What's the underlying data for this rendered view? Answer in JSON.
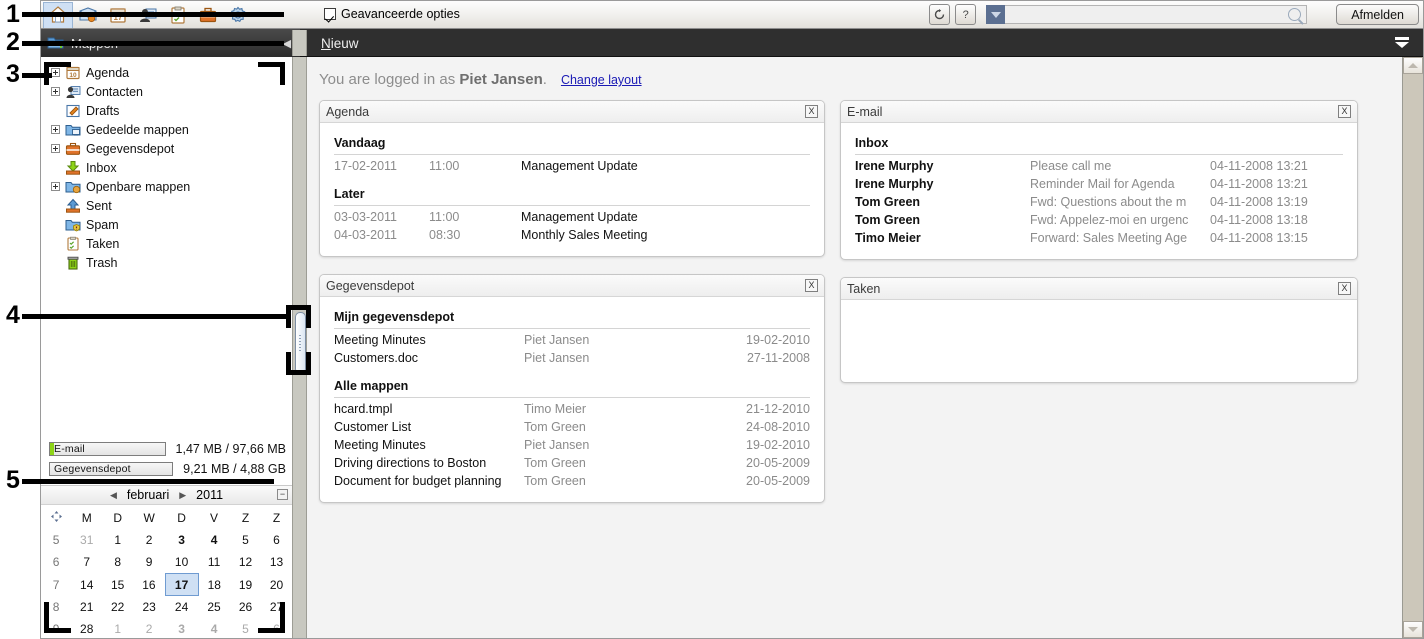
{
  "topbar": {
    "modules": [
      {
        "name": "portal",
        "icon": "home-icon",
        "active": true
      },
      {
        "name": "email",
        "icon": "mail-icon",
        "active": false
      },
      {
        "name": "calendar",
        "icon": "calendar-icon",
        "active": false
      },
      {
        "name": "contacts",
        "icon": "contacts-icon",
        "active": false
      },
      {
        "name": "tasks",
        "icon": "tasks-icon",
        "active": false
      },
      {
        "name": "infostore",
        "icon": "briefcase-icon",
        "active": false
      },
      {
        "name": "settings",
        "icon": "gear-icon",
        "active": false
      }
    ],
    "advanced_options_label": "Geavanceerde opties",
    "advanced_options_checked": true,
    "refresh_icon": "refresh-icon",
    "help_label": "?",
    "search_value": "",
    "search_placeholder": "",
    "logout_label": "Afmelden"
  },
  "folderbar": {
    "title": "Mappen",
    "collapse_icon": "collapse-left-icon"
  },
  "toolbar": {
    "new_label_accel": "N",
    "new_label_rest": "ieuw",
    "chevron_icon": "chevron-down-icon"
  },
  "tree": {
    "items": [
      {
        "label": "Agenda",
        "expandable": true,
        "icon": "calendar-folder-icon"
      },
      {
        "label": "Contacten",
        "expandable": true,
        "icon": "contacts-folder-icon"
      },
      {
        "label": "Drafts",
        "expandable": false,
        "icon": "drafts-folder-icon"
      },
      {
        "label": "Gedeelde mappen",
        "expandable": true,
        "icon": "shared-folder-icon"
      },
      {
        "label": "Gegevensdepot",
        "expandable": true,
        "icon": "infostore-folder-icon"
      },
      {
        "label": "Inbox",
        "expandable": false,
        "icon": "inbox-folder-icon"
      },
      {
        "label": "Openbare mappen",
        "expandable": true,
        "icon": "public-folder-icon"
      },
      {
        "label": "Sent",
        "expandable": false,
        "icon": "sent-folder-icon"
      },
      {
        "label": "Spam",
        "expandable": false,
        "icon": "spam-folder-icon"
      },
      {
        "label": "Taken",
        "expandable": false,
        "icon": "tasks-folder-icon"
      },
      {
        "label": "Trash",
        "expandable": false,
        "icon": "trash-folder-icon"
      }
    ]
  },
  "quota": [
    {
      "name": "E-mail",
      "value": "1,47 MB / 97,66 MB",
      "fill_percent": 3
    },
    {
      "name": "Gegevensdepot",
      "value": "9,21 MB / 4,88 GB",
      "fill_percent": 0
    }
  ],
  "minicalendar": {
    "prev_icon": "prev-arrow-icon",
    "next_icon": "next-arrow-icon",
    "month": "februari",
    "year": "2011",
    "minimize_label": "−",
    "weekday_headers": [
      "M",
      "D",
      "W",
      "D",
      "V",
      "Z",
      "Z"
    ],
    "weeks": [
      {
        "week": "5",
        "days": [
          {
            "d": "31",
            "other": true
          },
          {
            "d": "1"
          },
          {
            "d": "2"
          },
          {
            "d": "3",
            "bold": true
          },
          {
            "d": "4",
            "bold": true
          },
          {
            "d": "5"
          },
          {
            "d": "6"
          }
        ]
      },
      {
        "week": "6",
        "days": [
          {
            "d": "7"
          },
          {
            "d": "8"
          },
          {
            "d": "9"
          },
          {
            "d": "10"
          },
          {
            "d": "11"
          },
          {
            "d": "12"
          },
          {
            "d": "13"
          }
        ]
      },
      {
        "week": "7",
        "days": [
          {
            "d": "14"
          },
          {
            "d": "15"
          },
          {
            "d": "16"
          },
          {
            "d": "17",
            "today": true
          },
          {
            "d": "18"
          },
          {
            "d": "19"
          },
          {
            "d": "20"
          }
        ]
      },
      {
        "week": "8",
        "days": [
          {
            "d": "21"
          },
          {
            "d": "22"
          },
          {
            "d": "23"
          },
          {
            "d": "24"
          },
          {
            "d": "25"
          },
          {
            "d": "26"
          },
          {
            "d": "27"
          }
        ]
      },
      {
        "week": "9",
        "days": [
          {
            "d": "28"
          },
          {
            "d": "1",
            "other": true
          },
          {
            "d": "2",
            "other": true
          },
          {
            "d": "3",
            "other": true,
            "bold": true
          },
          {
            "d": "4",
            "other": true,
            "bold": true
          },
          {
            "d": "5",
            "other": true
          },
          {
            "d": "6",
            "other": true
          }
        ]
      }
    ]
  },
  "portal": {
    "logged_in_prefix": "You are logged in as ",
    "user_name": "Piet Jansen",
    "logged_in_suffix": ".",
    "change_layout_label": "Change layout",
    "close_label": "X",
    "widgets": {
      "agenda": {
        "title": "Agenda",
        "groups": [
          {
            "heading": "Vandaag",
            "rows": [
              {
                "date": "17-02-2011",
                "time": "11:00",
                "subject": "Management Update"
              }
            ]
          },
          {
            "heading": "Later",
            "rows": [
              {
                "date": "03-03-2011",
                "time": "11:00",
                "subject": "Management Update"
              },
              {
                "date": "04-03-2011",
                "time": "08:30",
                "subject": "Monthly Sales Meeting"
              }
            ]
          }
        ]
      },
      "email": {
        "title": "E-mail",
        "groups": [
          {
            "heading": "Inbox",
            "rows": [
              {
                "sender": "Irene Murphy",
                "subject": "Please call me",
                "date": "04-11-2008 13:21"
              },
              {
                "sender": "Irene Murphy",
                "subject": "Reminder Mail for Agenda",
                "date": "04-11-2008 13:21"
              },
              {
                "sender": "Tom Green",
                "subject": "Fwd: Questions about the m",
                "date": "04-11-2008 13:19"
              },
              {
                "sender": "Tom Green",
                "subject": "Fwd: Appelez-moi en urgenc",
                "date": "04-11-2008 13:18"
              },
              {
                "sender": "Timo Meier",
                "subject": "Forward: Sales Meeting Age",
                "date": "04-11-2008 13:15"
              }
            ]
          }
        ]
      },
      "infostore": {
        "title": "Gegevensdepot",
        "groups": [
          {
            "heading": "Mijn gegevensdepot",
            "rows": [
              {
                "name": "Meeting Minutes",
                "owner": "Piet Jansen",
                "date": "19-02-2010"
              },
              {
                "name": "Customers.doc",
                "owner": "Piet Jansen",
                "date": "27-11-2008"
              }
            ]
          },
          {
            "heading": "Alle mappen",
            "rows": [
              {
                "name": "hcard.tmpl",
                "owner": "Timo Meier",
                "date": "21-12-2010"
              },
              {
                "name": "Customer List",
                "owner": "Tom Green",
                "date": "24-08-2010"
              },
              {
                "name": "Meeting Minutes",
                "owner": "Piet Jansen",
                "date": "19-02-2010"
              },
              {
                "name": "Driving directions to Boston",
                "owner": "Tom Green",
                "date": "20-05-2009"
              },
              {
                "name": "Document for budget planning",
                "owner": "Tom Green",
                "date": "20-05-2009"
              }
            ]
          }
        ]
      },
      "tasks": {
        "title": "Taken",
        "groups": []
      }
    }
  },
  "annotations": [
    {
      "number": "1"
    },
    {
      "number": "2"
    },
    {
      "number": "3"
    },
    {
      "number": "4"
    },
    {
      "number": "5"
    }
  ]
}
